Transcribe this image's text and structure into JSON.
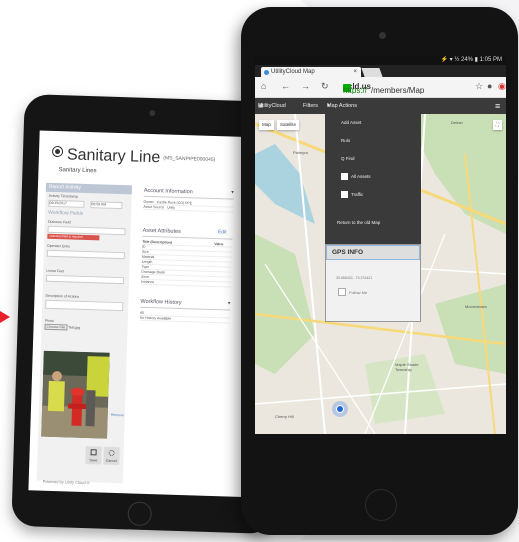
{
  "colors": {
    "accent": "#e8212a",
    "map_land": "#ebe7df",
    "map_green": "#c9dfb5",
    "map_water": "#aad3df",
    "toolbar": "#3a3a3a"
  },
  "back_tablet": {
    "record_title": "Sanitary Line",
    "record_id": "(MS_SANPIPE000045)",
    "subtitle": "Sanitary Lines",
    "left_panel": {
      "header": "Report Activity",
      "activity_timestamp_label": "Activity Timestamp",
      "date_value": "06/15/2017",
      "time_value": "09:58 AM",
      "workflow_label": "Workflow Fields",
      "outcome_label": "Outcome Field",
      "error_text": "Outcome field is required",
      "operator_label": "Operator Entry",
      "linear_feet_label": "Linear Feet",
      "description_label": "Description of Actions",
      "photo_label": "Photo",
      "choose_file": "Choose File",
      "no_file": "Test.jpg",
      "photo_caption": "Remove",
      "save_label": "Save",
      "cancel_label": "Cancel"
    },
    "right_panel": {
      "account_title": "Account Information",
      "account_rows": [
        [
          "Owner",
          "Castle Rock (CO) PPE"
        ],
        [
          "Asset Source",
          "Unity"
        ]
      ],
      "attributes_title": "Asset Attributes",
      "attributes_edit": "Edit",
      "attr_header": [
        "Title (Description)",
        "Value"
      ],
      "attr_rows": [
        "ID",
        "Size",
        "Material",
        "Length",
        "Type",
        "Drainage Basin",
        "Zone",
        "Instance"
      ],
      "history_title": "Workflow History",
      "history_rows": [
        "All",
        "No History Available"
      ]
    },
    "footer": "Powered by Unity Cloud ®"
  },
  "front_tablet": {
    "statusbar": "⚡ ▾ ½ 24% ▮ 1:05 PM",
    "tab_title": "UtilityCloud Map",
    "tab_close": "×",
    "url_https": "https://",
    "url_host": "ucld.us",
    "url_path": "/members/Map",
    "appbar": {
      "brand": "UtilityCloud",
      "filters": "Filters",
      "map_actions": "Map Actions",
      "caret": "▾",
      "menu_icon": "≡"
    },
    "map_buttons": [
      "Map",
      "Satellite"
    ],
    "dropdown": {
      "items": [
        "Add Asset",
        "Rulo",
        "Q Find",
        "All Assets",
        "Traffic",
        "Return to the old Map"
      ]
    },
    "gps": {
      "title": "GPS INFO",
      "coords": "39.658432, -74.374421",
      "follow": "Follow Me"
    },
    "map_labels": [
      "Palmyra",
      "Delran",
      "Moorestown",
      "Maple Shade Township",
      "Cherry Hill"
    ]
  }
}
